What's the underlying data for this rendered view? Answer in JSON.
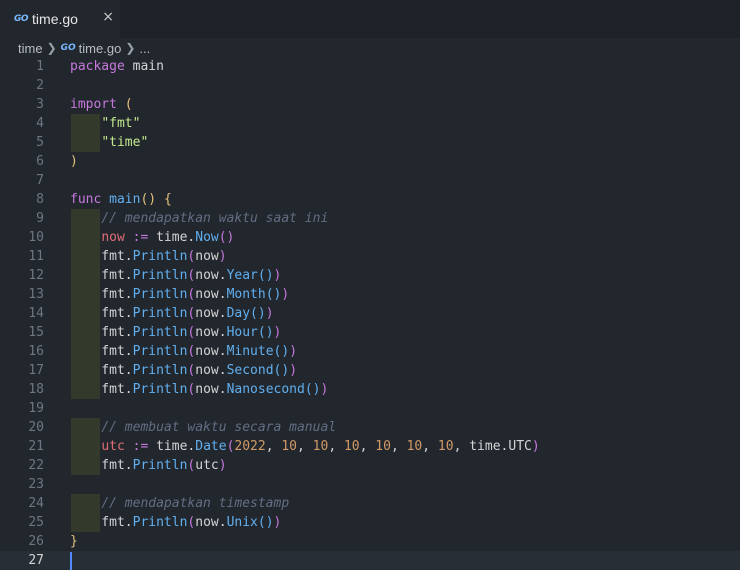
{
  "tab": {
    "icon": "go-file-icon",
    "icon_text": "GO",
    "name": "time.go",
    "close": "×"
  },
  "breadcrumb": {
    "folder": "time",
    "file": "time.go",
    "more": "..."
  },
  "lines": [
    {
      "n": "1",
      "t": [
        {
          "c": "pk",
          "s": "package"
        },
        {
          "c": "pl",
          "s": " main"
        }
      ]
    },
    {
      "n": "2",
      "t": []
    },
    {
      "n": "3",
      "t": [
        {
          "c": "pk",
          "s": "import"
        },
        {
          "c": "pl",
          "s": " "
        },
        {
          "c": "p1",
          "s": "("
        }
      ]
    },
    {
      "n": "4",
      "g": true,
      "t": [
        {
          "c": "pl",
          "s": "    "
        },
        {
          "c": "str",
          "s": "\"fmt\""
        }
      ]
    },
    {
      "n": "5",
      "g": true,
      "t": [
        {
          "c": "pl",
          "s": "    "
        },
        {
          "c": "str",
          "s": "\"time\""
        }
      ]
    },
    {
      "n": "6",
      "t": [
        {
          "c": "p1",
          "s": ")"
        }
      ]
    },
    {
      "n": "7",
      "t": []
    },
    {
      "n": "8",
      "t": [
        {
          "c": "pk",
          "s": "func"
        },
        {
          "c": "pl",
          "s": " "
        },
        {
          "c": "fn",
          "s": "main"
        },
        {
          "c": "p1",
          "s": "()"
        },
        {
          "c": "pl",
          "s": " "
        },
        {
          "c": "p1",
          "s": "{"
        }
      ]
    },
    {
      "n": "9",
      "g": true,
      "t": [
        {
          "c": "pl",
          "s": "    "
        },
        {
          "c": "cm",
          "s": "// mendapatkan waktu saat ini"
        }
      ]
    },
    {
      "n": "10",
      "g": true,
      "t": [
        {
          "c": "pl",
          "s": "    "
        },
        {
          "c": "var",
          "s": "now"
        },
        {
          "c": "pl",
          "s": " "
        },
        {
          "c": "pk",
          "s": ":="
        },
        {
          "c": "pl",
          "s": " time."
        },
        {
          "c": "fn",
          "s": "Now"
        },
        {
          "c": "p2",
          "s": "()"
        }
      ]
    },
    {
      "n": "11",
      "g": true,
      "t": [
        {
          "c": "pl",
          "s": "    fmt."
        },
        {
          "c": "fn",
          "s": "Println"
        },
        {
          "c": "p2",
          "s": "("
        },
        {
          "c": "pl",
          "s": "now"
        },
        {
          "c": "p2",
          "s": ")"
        }
      ]
    },
    {
      "n": "12",
      "g": true,
      "t": [
        {
          "c": "pl",
          "s": "    fmt."
        },
        {
          "c": "fn",
          "s": "Println"
        },
        {
          "c": "p2",
          "s": "("
        },
        {
          "c": "pl",
          "s": "now."
        },
        {
          "c": "fn",
          "s": "Year"
        },
        {
          "c": "p3",
          "s": "()"
        },
        {
          "c": "p2",
          "s": ")"
        }
      ]
    },
    {
      "n": "13",
      "g": true,
      "t": [
        {
          "c": "pl",
          "s": "    fmt."
        },
        {
          "c": "fn",
          "s": "Println"
        },
        {
          "c": "p2",
          "s": "("
        },
        {
          "c": "pl",
          "s": "now."
        },
        {
          "c": "fn",
          "s": "Month"
        },
        {
          "c": "p3",
          "s": "()"
        },
        {
          "c": "p2",
          "s": ")"
        }
      ]
    },
    {
      "n": "14",
      "g": true,
      "t": [
        {
          "c": "pl",
          "s": "    fmt."
        },
        {
          "c": "fn",
          "s": "Println"
        },
        {
          "c": "p2",
          "s": "("
        },
        {
          "c": "pl",
          "s": "now."
        },
        {
          "c": "fn",
          "s": "Day"
        },
        {
          "c": "p3",
          "s": "()"
        },
        {
          "c": "p2",
          "s": ")"
        }
      ]
    },
    {
      "n": "15",
      "g": true,
      "t": [
        {
          "c": "pl",
          "s": "    fmt."
        },
        {
          "c": "fn",
          "s": "Println"
        },
        {
          "c": "p2",
          "s": "("
        },
        {
          "c": "pl",
          "s": "now."
        },
        {
          "c": "fn",
          "s": "Hour"
        },
        {
          "c": "p3",
          "s": "()"
        },
        {
          "c": "p2",
          "s": ")"
        }
      ]
    },
    {
      "n": "16",
      "g": true,
      "t": [
        {
          "c": "pl",
          "s": "    fmt."
        },
        {
          "c": "fn",
          "s": "Println"
        },
        {
          "c": "p2",
          "s": "("
        },
        {
          "c": "pl",
          "s": "now."
        },
        {
          "c": "fn",
          "s": "Minute"
        },
        {
          "c": "p3",
          "s": "()"
        },
        {
          "c": "p2",
          "s": ")"
        }
      ]
    },
    {
      "n": "17",
      "g": true,
      "t": [
        {
          "c": "pl",
          "s": "    fmt."
        },
        {
          "c": "fn",
          "s": "Println"
        },
        {
          "c": "p2",
          "s": "("
        },
        {
          "c": "pl",
          "s": "now."
        },
        {
          "c": "fn",
          "s": "Second"
        },
        {
          "c": "p3",
          "s": "()"
        },
        {
          "c": "p2",
          "s": ")"
        }
      ]
    },
    {
      "n": "18",
      "g": true,
      "t": [
        {
          "c": "pl",
          "s": "    fmt."
        },
        {
          "c": "fn",
          "s": "Println"
        },
        {
          "c": "p2",
          "s": "("
        },
        {
          "c": "pl",
          "s": "now."
        },
        {
          "c": "fn",
          "s": "Nanosecond"
        },
        {
          "c": "p3",
          "s": "()"
        },
        {
          "c": "p2",
          "s": ")"
        }
      ]
    },
    {
      "n": "19",
      "t": []
    },
    {
      "n": "20",
      "g": true,
      "t": [
        {
          "c": "pl",
          "s": "    "
        },
        {
          "c": "cm",
          "s": "// membuat waktu secara manual"
        }
      ]
    },
    {
      "n": "21",
      "g": true,
      "t": [
        {
          "c": "pl",
          "s": "    "
        },
        {
          "c": "var",
          "s": "utc"
        },
        {
          "c": "pl",
          "s": " "
        },
        {
          "c": "pk",
          "s": ":="
        },
        {
          "c": "pl",
          "s": " time."
        },
        {
          "c": "fn",
          "s": "Date"
        },
        {
          "c": "p2",
          "s": "("
        },
        {
          "c": "num",
          "s": "2022"
        },
        {
          "c": "pl",
          "s": ", "
        },
        {
          "c": "num",
          "s": "10"
        },
        {
          "c": "pl",
          "s": ", "
        },
        {
          "c": "num",
          "s": "10"
        },
        {
          "c": "pl",
          "s": ", "
        },
        {
          "c": "num",
          "s": "10"
        },
        {
          "c": "pl",
          "s": ", "
        },
        {
          "c": "num",
          "s": "10"
        },
        {
          "c": "pl",
          "s": ", "
        },
        {
          "c": "num",
          "s": "10"
        },
        {
          "c": "pl",
          "s": ", "
        },
        {
          "c": "num",
          "s": "10"
        },
        {
          "c": "pl",
          "s": ", time.UTC"
        },
        {
          "c": "p2",
          "s": ")"
        }
      ]
    },
    {
      "n": "22",
      "g": true,
      "t": [
        {
          "c": "pl",
          "s": "    fmt."
        },
        {
          "c": "fn",
          "s": "Println"
        },
        {
          "c": "p2",
          "s": "("
        },
        {
          "c": "pl",
          "s": "utc"
        },
        {
          "c": "p2",
          "s": ")"
        }
      ]
    },
    {
      "n": "23",
      "t": []
    },
    {
      "n": "24",
      "g": true,
      "t": [
        {
          "c": "pl",
          "s": "    "
        },
        {
          "c": "cm",
          "s": "// mendapatkan timestamp"
        }
      ]
    },
    {
      "n": "25",
      "g": true,
      "t": [
        {
          "c": "pl",
          "s": "    fmt."
        },
        {
          "c": "fn",
          "s": "Println"
        },
        {
          "c": "p2",
          "s": "("
        },
        {
          "c": "pl",
          "s": "now."
        },
        {
          "c": "fn",
          "s": "Unix"
        },
        {
          "c": "p3",
          "s": "()"
        },
        {
          "c": "p2",
          "s": ")"
        }
      ]
    },
    {
      "n": "26",
      "t": [
        {
          "c": "p1",
          "s": "}"
        }
      ]
    },
    {
      "n": "27",
      "cur": true,
      "t": []
    }
  ]
}
